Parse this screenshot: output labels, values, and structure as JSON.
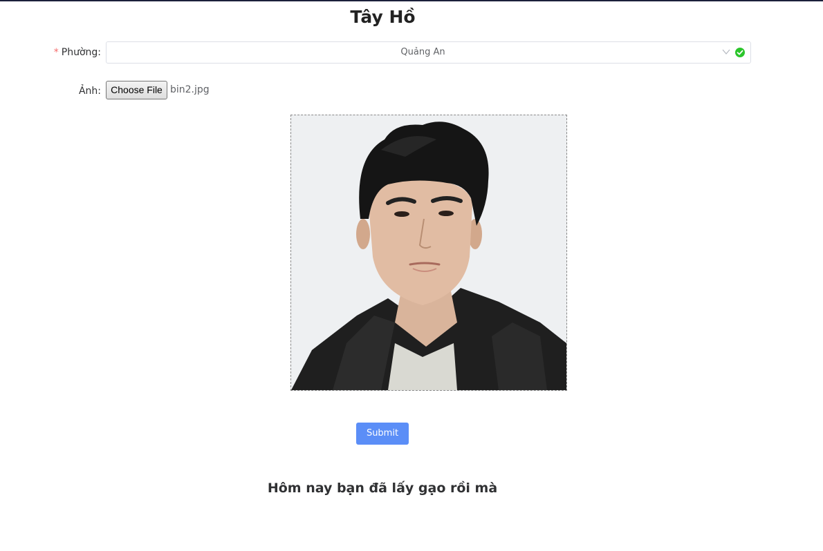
{
  "title": "Tây Hồ",
  "form": {
    "ward": {
      "required_mark": "*",
      "label": "Phường",
      "value": "Quảng An"
    },
    "photo": {
      "label": "Ảnh",
      "button_label": "Choose File",
      "file_name": "bin2.jpg"
    },
    "submit_label": "Submit"
  },
  "message": "Hôm nay bạn đã lấy gạo rồi mà",
  "colors": {
    "primary": "#5b8ef7",
    "success": "#2bc52b",
    "required": "#f56c6c"
  },
  "icons": {
    "select_arrow": "chevron-down-icon",
    "valid": "check-circle-icon"
  }
}
